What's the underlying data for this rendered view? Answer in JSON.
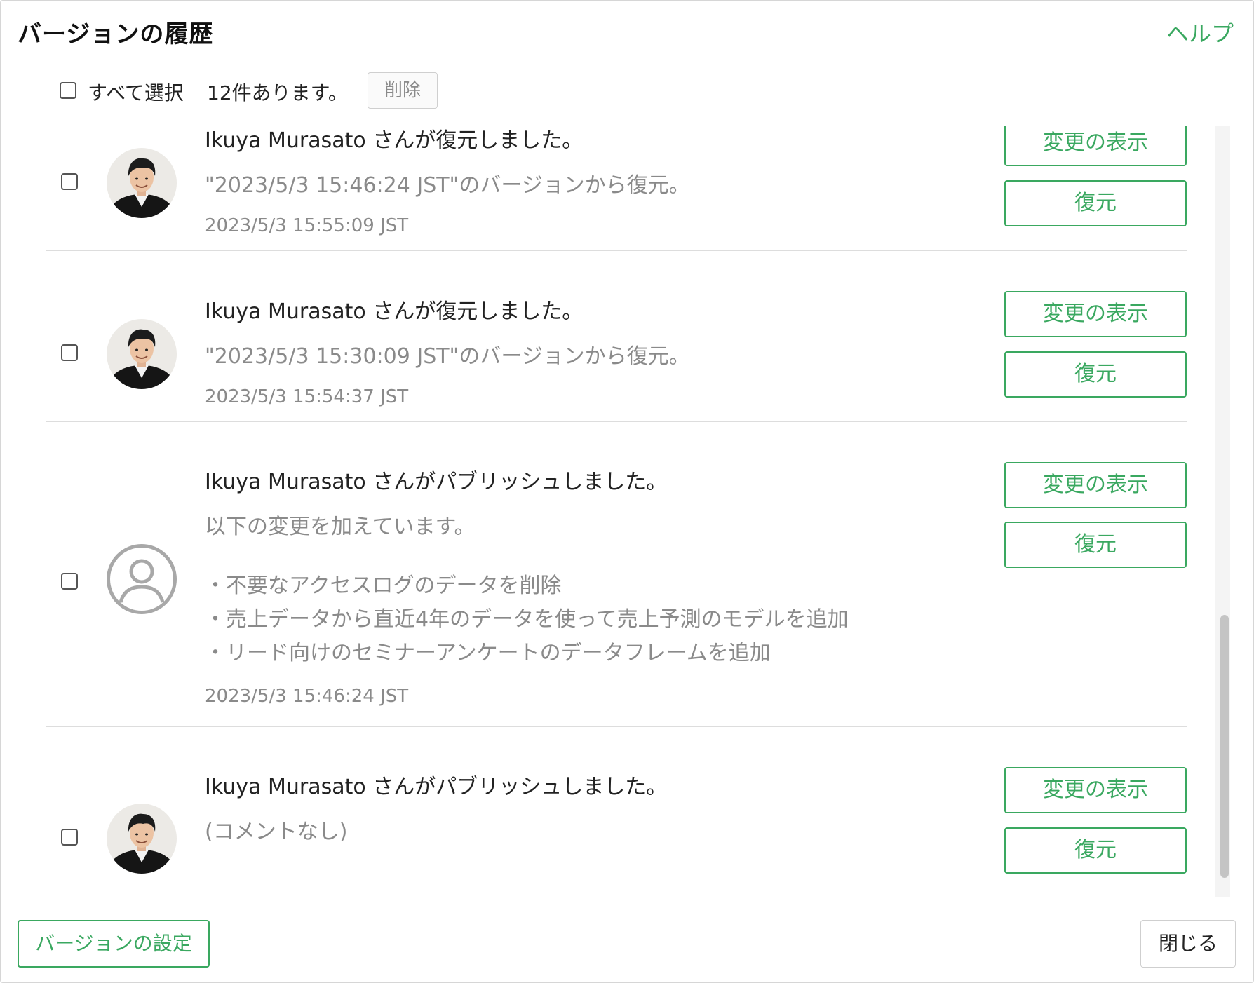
{
  "header": {
    "title": "バージョンの履歴",
    "help_label": "ヘルプ"
  },
  "toolbar": {
    "select_all_label": "すべて選択",
    "count_label": "12件あります。",
    "delete_label": "削除"
  },
  "entries": [
    {
      "title": "Ikuya Murasato さんが復元しました。",
      "message": "\"2023/5/3 15:46:24 JST\"のバージョンから復元。",
      "timestamp": "2023/5/3 15:55:09 JST",
      "avatar": "user-photo",
      "show_changes_label": "変更の表示",
      "restore_label": "復元"
    },
    {
      "title": "Ikuya Murasato さんが復元しました。",
      "message": "\"2023/5/3 15:30:09 JST\"のバージョンから復元。",
      "timestamp": "2023/5/3 15:54:37 JST",
      "avatar": "user-photo",
      "show_changes_label": "変更の表示",
      "restore_label": "復元"
    },
    {
      "title": "Ikuya Murasato さんがパブリッシュしました。",
      "message": "以下の変更を加えています。",
      "bullets": [
        "・不要なアクセスログのデータを削除",
        "・売上データから直近4年のデータを使って売上予測のモデルを追加",
        "・リード向けのセミナーアンケートのデータフレームを追加"
      ],
      "timestamp": "2023/5/3 15:46:24 JST",
      "avatar": "default-user-icon",
      "show_changes_label": "変更の表示",
      "restore_label": "復元"
    },
    {
      "title": "Ikuya Murasato さんがパブリッシュしました。",
      "message": "(コメントなし)",
      "avatar": "user-photo",
      "show_changes_label": "変更の表示",
      "restore_label": "復元"
    }
  ],
  "footer": {
    "settings_label": "バージョンの設定",
    "close_label": "閉じる"
  },
  "colors": {
    "accent": "#3aa860",
    "muted_text": "#8a8a8a",
    "divider": "#dddddd"
  }
}
